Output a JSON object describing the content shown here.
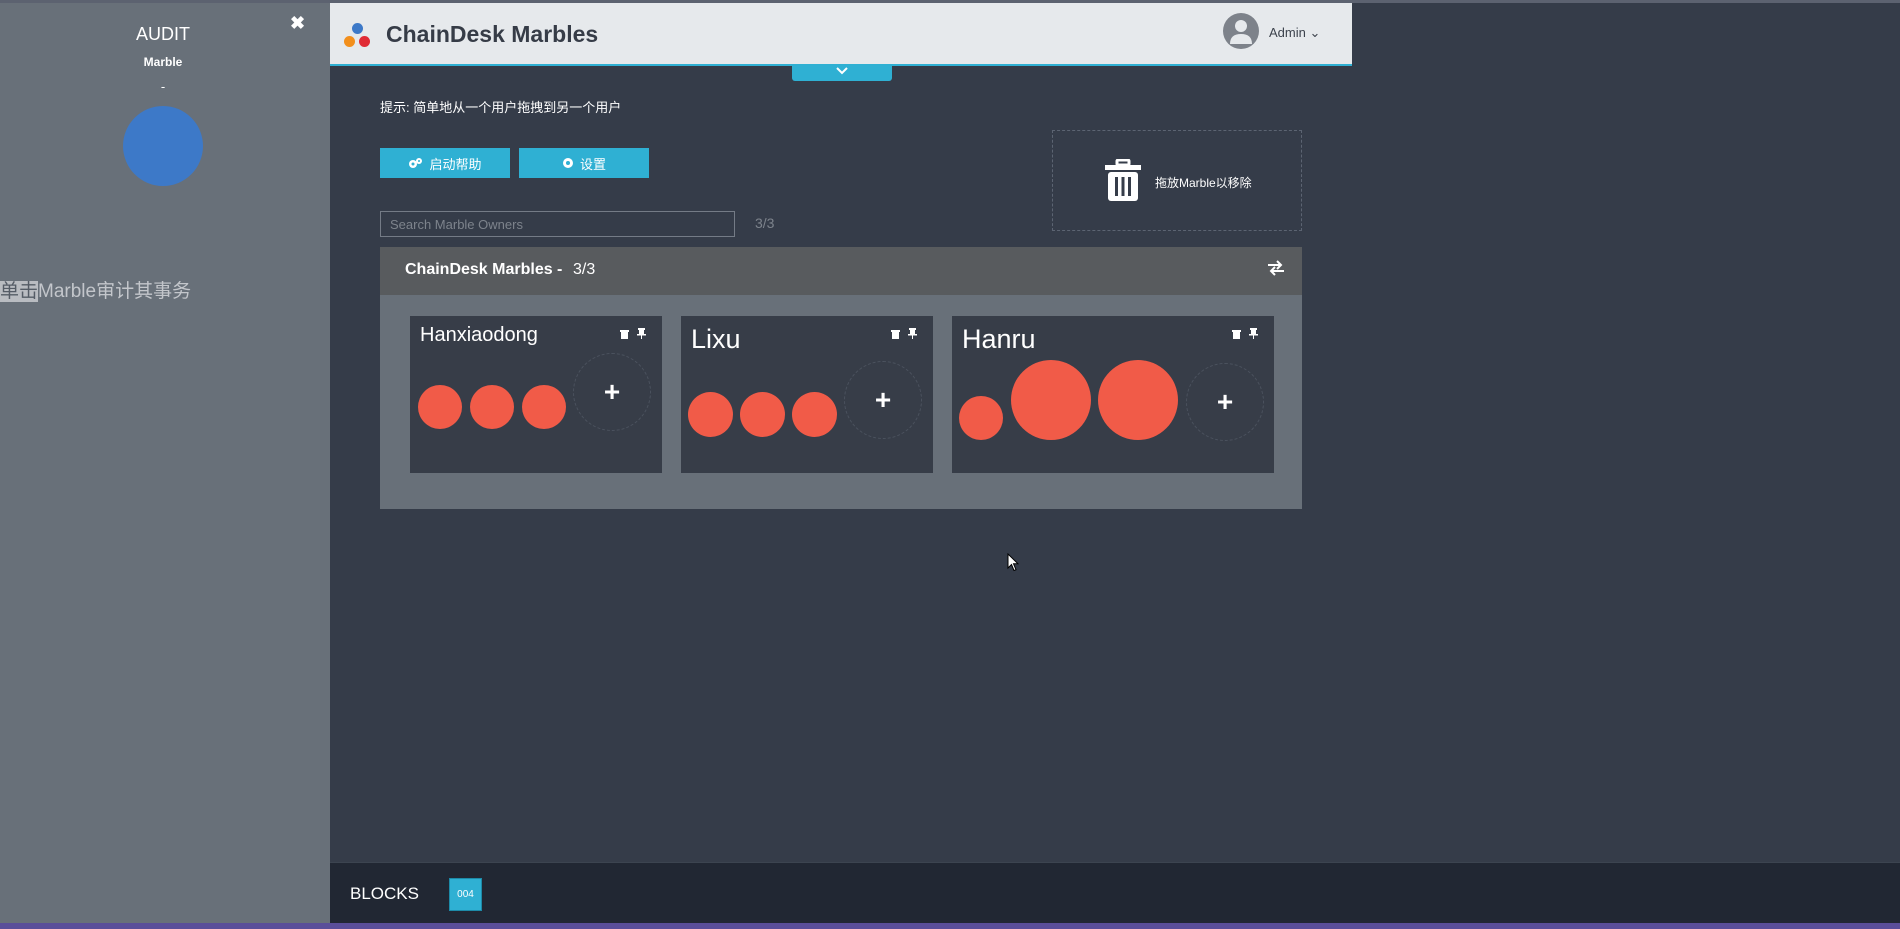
{
  "audit": {
    "title": "AUDIT",
    "subtitle": "Marble",
    "dash": "-",
    "hint_highlight": "单击",
    "hint_rest": "Marble审计其事务",
    "marble_color": "#3d79c8"
  },
  "header": {
    "title": "ChainDesk Marbles",
    "user": "Admin"
  },
  "tip": "提示: 简单地从一个用户拖拽到另一个用户",
  "buttons": {
    "help": "启动帮助",
    "settings": "设置"
  },
  "trash": {
    "label": "拖放Marble以移除"
  },
  "search": {
    "placeholder": "Search Marble Owners",
    "count": "3/3"
  },
  "panel": {
    "title": "ChainDesk Marbles -",
    "count": "3/3"
  },
  "owners": [
    {
      "name": "Hanxiaodong",
      "marbles": [
        "small",
        "small",
        "small"
      ]
    },
    {
      "name": "Lixu",
      "marbles": [
        "small",
        "small",
        "small"
      ]
    },
    {
      "name": "Hanru",
      "marbles": [
        "small",
        "large",
        "large"
      ]
    }
  ],
  "footer": {
    "label": "BLOCKS",
    "block": "004"
  },
  "colors": {
    "accent": "#2fb0d3",
    "marble": "#f15b48",
    "background": "#353c49",
    "sidebar": "#687079"
  }
}
